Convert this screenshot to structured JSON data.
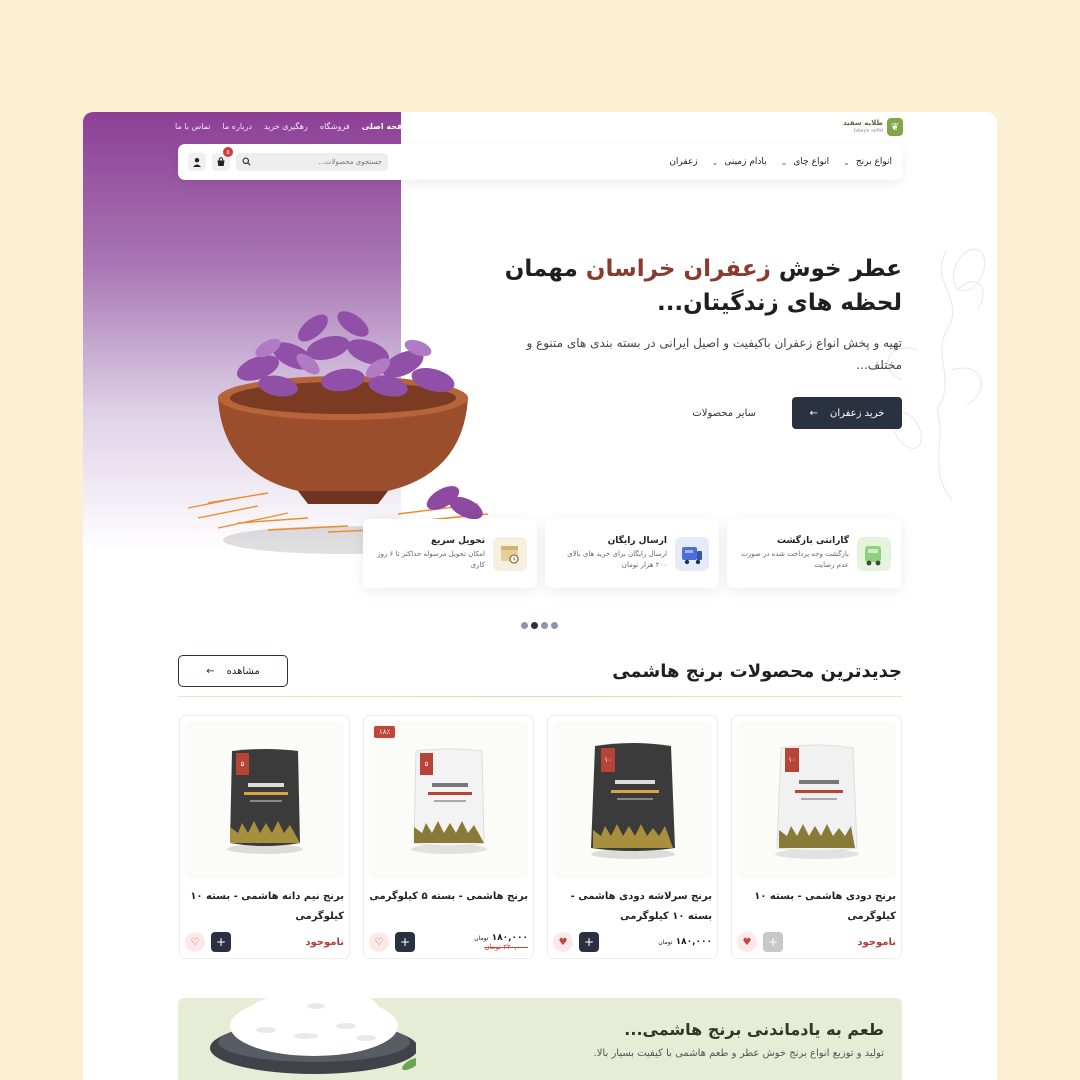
{
  "colors": {
    "brand_purple": "#8d3f96",
    "accent_red": "#8b3a2f",
    "dark_button": "#2a3242",
    "page_bg": "#fdefd3",
    "banner_bg": "#e7ecd7"
  },
  "logo": {
    "name": "طلایه سفید",
    "tagline": "talaye sefid"
  },
  "toplinks": {
    "items": [
      "صفحه اصلی",
      "فروشگاه",
      "رهگیری خرید",
      "درباره ما",
      "تماس با ما"
    ]
  },
  "nav": {
    "menu": [
      "انواع برنج",
      "انواع چای",
      "بادام زمینی",
      "زعفران"
    ],
    "search_placeholder": "جستجوی محصولات...",
    "cart_count": "۵"
  },
  "hero": {
    "title_pre": "عطر خوش ",
    "title_accent": "زعفران خراسان",
    "title_post": " مهمان لحظه های زندگیتان...",
    "subtitle": "تهیه و پخش انواع زعفران باکیفیت و اصیل ایرانی در بسته بندی های متنوع و مختلف...",
    "primary_btn": "خرید زعفران",
    "secondary_btn": "سایر محصولات"
  },
  "features": [
    {
      "title": "گارانتی بازگشت",
      "desc": "بازگشت وجه پرداخت شده در صورت عدم رضایت",
      "icon": "return-truck-icon"
    },
    {
      "title": "ارسال رایگان",
      "desc": "ارسال رایگان برای خرید های بالای ۲۰۰ هزار تومان",
      "icon": "free-shipping-icon"
    },
    {
      "title": "تحویل سریع",
      "desc": "امکان تحویل مرسوله حداکثر تا ۶ روز کاری",
      "icon": "fast-delivery-icon"
    }
  ],
  "slider": {
    "dots": 4,
    "active": 1
  },
  "products_section": {
    "title": "جدیدترین محصولات برنج هاشمی",
    "view_btn": "مشاهده"
  },
  "products": [
    {
      "name": "برنج دودی هاشمی - بسته ۱۰ کیلوگرمی",
      "status": "ناموجود",
      "in_stock": false,
      "bag": "white",
      "bag_weight": "۱۰",
      "favorited": true
    },
    {
      "name": "برنج سرلاشه دودی هاشمی - بسته ۱۰ کیلوگرمی",
      "price": "۱۸۰,۰۰۰",
      "currency": "تومان",
      "in_stock": true,
      "bag": "black",
      "bag_weight": "۱۰",
      "favorited": true
    },
    {
      "name": "برنج هاشمی - بسته ۵ کیلوگرمی",
      "price": "۱۸۰,۰۰۰",
      "old_price": "۲۲۰,۰۰۰",
      "currency": "تومان",
      "discount": "۱۸٪",
      "in_stock": true,
      "bag": "white",
      "bag_weight": "۵",
      "favorited": false
    },
    {
      "name": "برنج نیم دانه هاشمی - بسته ۱۰ کیلوگرمی",
      "status": "ناموجود",
      "in_stock": true,
      "bag": "black",
      "bag_weight": "۵",
      "favorited": false
    }
  ],
  "banner": {
    "title": "طعم به یادماندنی برنج هاشمی...",
    "subtitle": "تولید و توزیع انواع برنج خوش عطر و طعم هاشمی با کیفیت بسیار بالا."
  }
}
